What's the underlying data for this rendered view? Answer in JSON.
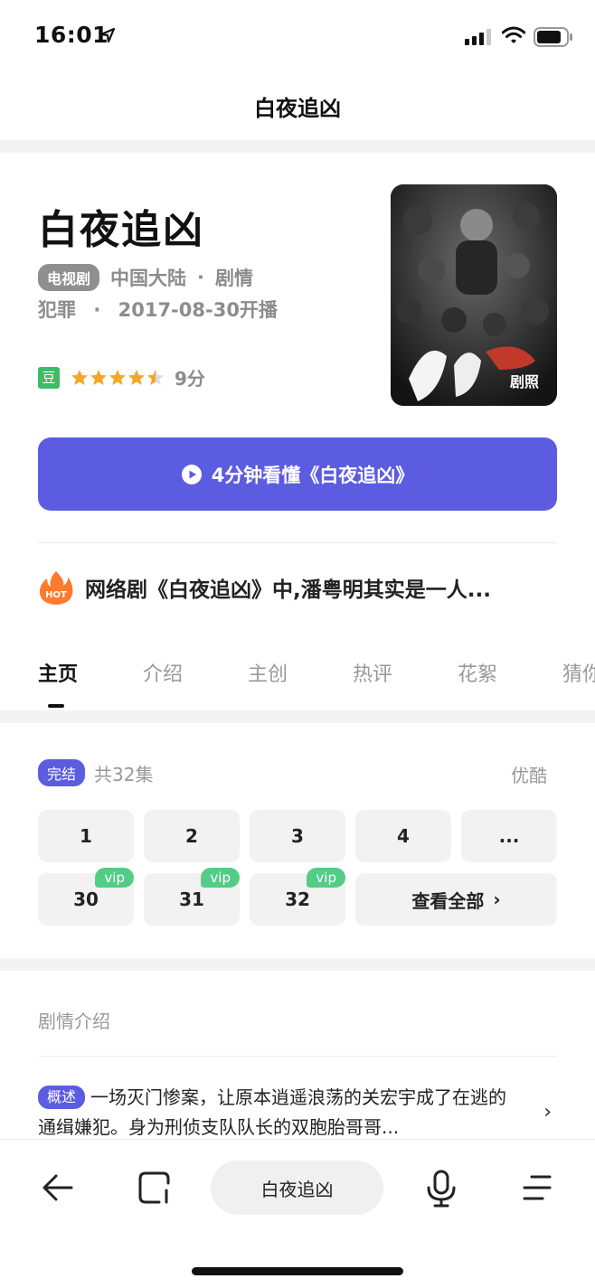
{
  "status_bar": {
    "time": "16:01"
  },
  "nav": {
    "title": "白夜追凶"
  },
  "show": {
    "title": "白夜追凶",
    "type_badge": "电视剧",
    "region": "中国大陆",
    "genre": "剧情",
    "genre2": "犯罪",
    "air_date": "2017-08-30开播",
    "douban_label": "豆",
    "star_rating": 4.5,
    "score": "9分",
    "poster_label": "剧照"
  },
  "watch_button": {
    "label": "4分钟看懂《白夜追凶》"
  },
  "hot": {
    "badge": "HOT",
    "text": "网络剧《白夜追凶》中,潘粤明其实是一人..."
  },
  "tabs": [
    "主页",
    "介绍",
    "主创",
    "热评",
    "花絮",
    "猜你"
  ],
  "episodes": {
    "status_badge": "完结",
    "count": "共32集",
    "platform": "优酷",
    "row1": [
      "1",
      "2",
      "3",
      "4",
      "..."
    ],
    "row2": [
      {
        "num": "30",
        "tag": "vip"
      },
      {
        "num": "31",
        "tag": "vip"
      },
      {
        "num": "32",
        "tag": "vip"
      }
    ],
    "view_all": "查看全部",
    "view_all_chevron": "›"
  },
  "plot": {
    "title": "剧情介绍",
    "badge": "概述",
    "text": "一场灭门惨案，让原本逍遥浪荡的关宏宇成了在逃的通缉嫌犯。身为刑侦支队队长的双胞胎哥哥...",
    "chevron": "›"
  },
  "bottom_bar": {
    "search_text": "白夜追凶"
  },
  "colors": {
    "accent": "#5c5ce0",
    "vip": "#53cc86",
    "star": "#f5a623",
    "douban": "#3dbb65"
  }
}
